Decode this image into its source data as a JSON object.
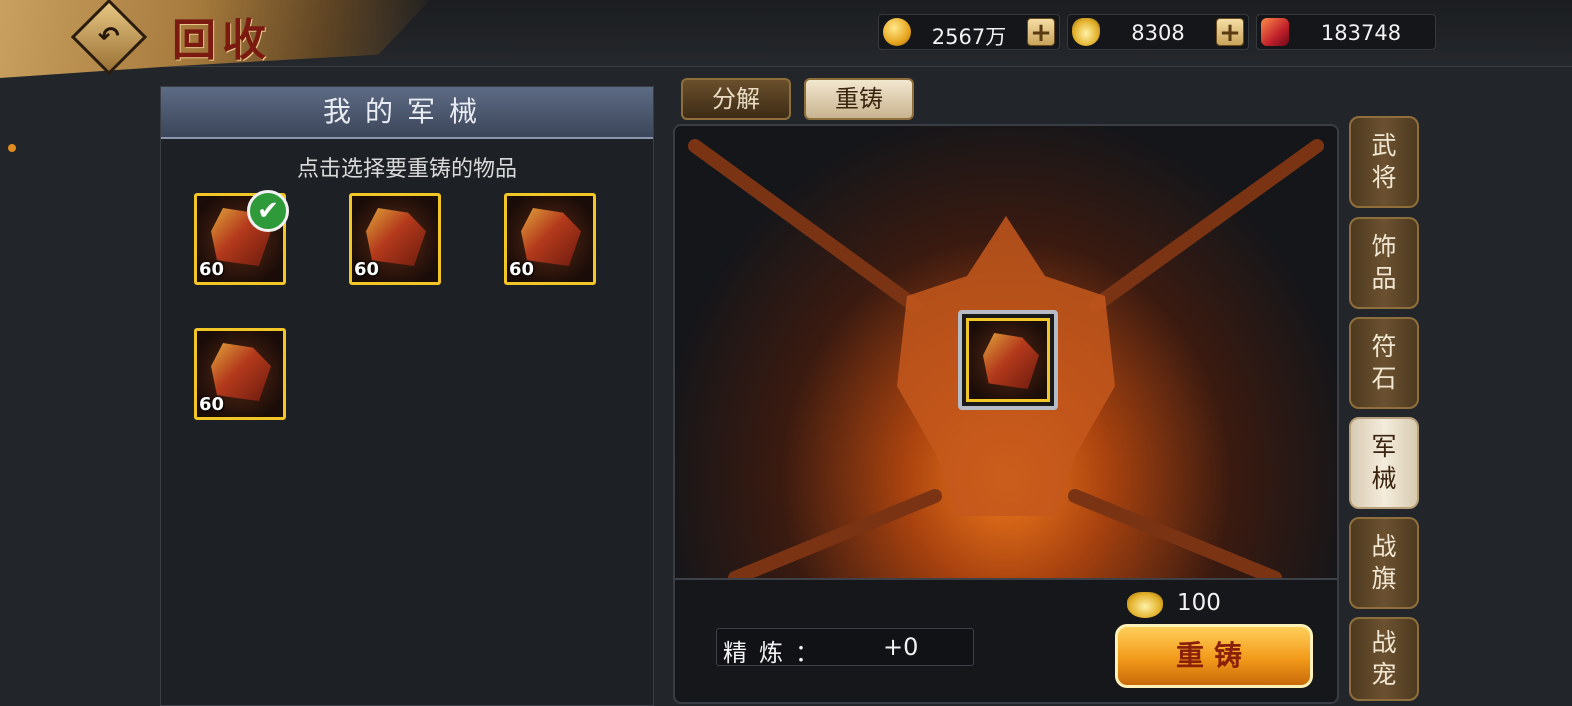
{
  "header": {
    "back_icon": "back-arrow-icon",
    "title": "回收"
  },
  "resources": [
    {
      "name": "coins",
      "icon": "gold-coin-icon",
      "value": "2567万",
      "plus": "+"
    },
    {
      "name": "ingots",
      "icon": "gold-ingot-icon",
      "value": "8308",
      "plus": "+"
    },
    {
      "name": "gems",
      "icon": "red-gem-icon",
      "value": "183748"
    }
  ],
  "left_panel": {
    "title": "我的军械",
    "hint": "点击选择要重铸的物品",
    "items": [
      {
        "level": "60",
        "selected": true,
        "icon": "siege-chariot-icon"
      },
      {
        "level": "60",
        "selected": false,
        "icon": "war-beast-cart-icon"
      },
      {
        "level": "60",
        "selected": false,
        "icon": "war-chariot-icon"
      },
      {
        "level": "60",
        "selected": false,
        "icon": "catapult-icon"
      }
    ],
    "check_icon": "checkmark-icon"
  },
  "tabs": [
    {
      "label": "分解",
      "active": false
    },
    {
      "label": "重铸",
      "active": true
    }
  ],
  "recast": {
    "cost_icon": "gold-ingot-icon",
    "cost": "100",
    "refine_label": "精炼：",
    "refine_value": "+0",
    "button_label": "重铸"
  },
  "side_tabs": [
    {
      "label": "武将",
      "active": false
    },
    {
      "label": "饰品",
      "active": false
    },
    {
      "label": "符石",
      "active": false
    },
    {
      "label": "军械",
      "active": true
    },
    {
      "label": "战旗",
      "active": false
    },
    {
      "label": "战宠",
      "active": false
    }
  ],
  "colors": {
    "accent_gold": "#f3c627",
    "button_orange": "#f29a1a",
    "background": "#22262b"
  }
}
